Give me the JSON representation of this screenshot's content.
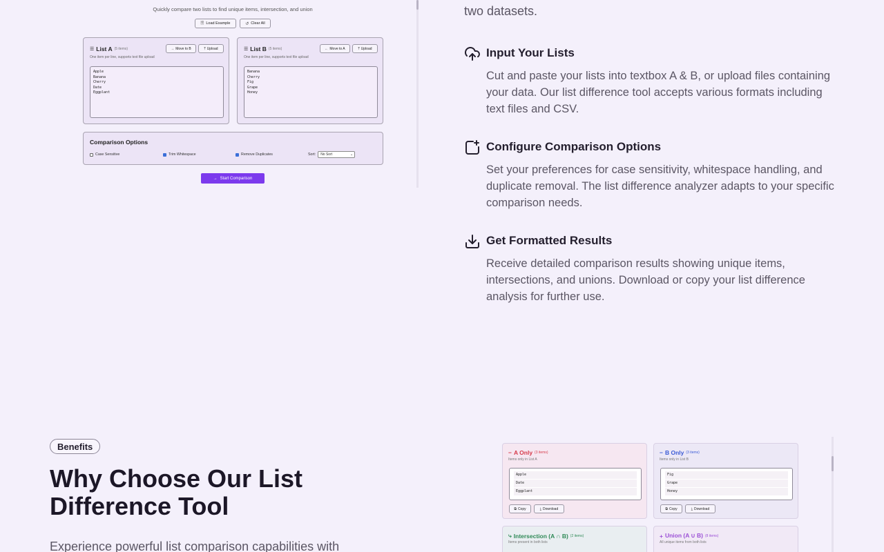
{
  "tool_preview": {
    "subtitle": "Quickly compare two lists to find unique items, intersection, and union",
    "load_example": "Load Example",
    "clear_all": "Clear All",
    "list_a": {
      "title": "List A",
      "count": "(5 items)",
      "hint": "One item per line, supports text file upload",
      "move_label": "Move to B",
      "upload_label": "Upload",
      "items": [
        "Apple",
        "Banana",
        "Cherry",
        "Date",
        "Eggplant"
      ]
    },
    "list_b": {
      "title": "List B",
      "count": "(5 items)",
      "hint": "One item per line, supports text file upload",
      "move_label": "Move to A",
      "upload_label": "Upload",
      "items": [
        "Banana",
        "Cherry",
        "Fig",
        "Grape",
        "Honey"
      ]
    },
    "options": {
      "title": "Comparison Options",
      "case_sensitive": "Case Sensitive",
      "trim_whitespace": "Trim Whitespace",
      "remove_duplicates": "Remove Duplicates",
      "sort_label": "Sort:",
      "sort_value": "No Sort"
    },
    "start_label": "Start Comparison"
  },
  "how_it_works": {
    "intro_tail": "two datasets.",
    "steps": [
      {
        "title": "Input Your Lists",
        "icon": "cloud-upload-icon",
        "desc": "Cut and paste your lists into textbox A & B, or upload files containing your data. Our list difference tool accepts various formats including text files and CSV."
      },
      {
        "title": "Configure Comparison Options",
        "icon": "sparkle-square-icon",
        "desc": "Set your preferences for case sensitivity, whitespace handling, and duplicate removal. The list difference analyzer adapts to your specific comparison needs."
      },
      {
        "title": "Get Formatted Results",
        "icon": "download-tray-icon",
        "desc": "Receive detailed comparison results showing unique items, intersections, and unions. Download or copy your list difference analysis for further use."
      }
    ]
  },
  "benefits": {
    "badge": "Benefits",
    "title": "Why Choose Our List Difference Tool",
    "desc": "Experience powerful list comparison capabilities with"
  },
  "results_preview": {
    "a_only": {
      "title": "A Only",
      "count": "(3 items)",
      "hint": "Items only in List A",
      "items": [
        "Apple",
        "Date",
        "Eggplant"
      ]
    },
    "b_only": {
      "title": "B Only",
      "count": "(3 items)",
      "hint": "Items only in List B",
      "items": [
        "Fig",
        "Grape",
        "Honey"
      ]
    },
    "intersection": {
      "title": "Intersection (A ∩ B)",
      "count": "(2 items)",
      "hint": "Items present in both lists"
    },
    "union": {
      "title": "Union (A ∪ B)",
      "count": "(8 items)",
      "hint": "All unique items from both lists"
    },
    "copy_label": "Copy",
    "download_label": "Download"
  },
  "colors": {
    "accent": "#7c3aed",
    "a_only": "#d63a4a",
    "b_only": "#3b5bd6",
    "intersection": "#2f8a57",
    "union": "#9b4fd6"
  }
}
